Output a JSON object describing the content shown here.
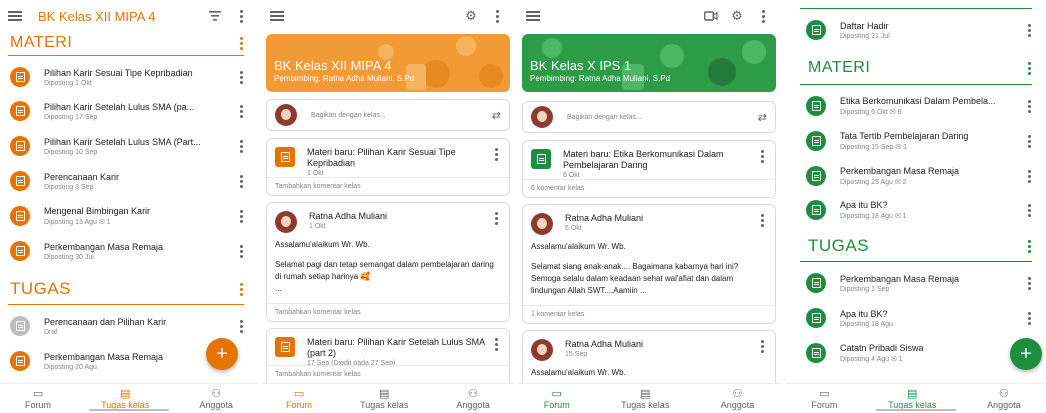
{
  "colors": {
    "orange": "#e37400",
    "green": "#1e8e3e",
    "grey_icon": "#bdbdbd"
  },
  "screen1": {
    "title": "BK Kelas XII MIPA 4",
    "materi_header": "MATERI",
    "materi": [
      {
        "title": "Pilihan Karir Sesuai Tipe Kepribadian",
        "sub": "Diposting 1 Okt"
      },
      {
        "title": "Pilihan Karir Setelah Lulus SMA (pa...",
        "sub": "Diposting 17 Sep"
      },
      {
        "title": "Pilihan Karir Setelah Lulus SMA (Part...",
        "sub": "Diposting 10 Sep"
      },
      {
        "title": "Perencanaan Karir",
        "sub": "Diposting 3 Sep"
      },
      {
        "title": "Mengenal Bimbingan Karir",
        "sub": "Diposting 13 Agu  ✉ 1"
      },
      {
        "title": "Perkembangan Masa Remaja",
        "sub": "Diposting 30 Jul"
      }
    ],
    "tugas_header": "TUGAS",
    "tugas": [
      {
        "title": "Perencanaan dan Pilihan Karir",
        "sub": "Draf"
      },
      {
        "title": "Perkembangan Masa Remaja",
        "sub": "Diposting 20 Agu"
      }
    ],
    "fab": "+",
    "nav": {
      "forum": "Forum",
      "tugas": "Tugas kelas",
      "anggota": "Anggota"
    }
  },
  "screen2": {
    "banner_title": "BK Kelas XII MIPA 4",
    "banner_sub": "Pembimbing: Ratna Adha Muliani, S.Pd",
    "share_placeholder": "Bagikan dengan kelas...",
    "post1": {
      "title": "Materi baru: Pilihan Karir Sesuai Tipe Kepribadian",
      "date": "1 Okt",
      "foot": "Tambahkan komentar kelas"
    },
    "post2": {
      "author": "Ratna Adha Muliani",
      "date": "1 Okt",
      "line1": "Assalamu'alaikum Wr. Wb.",
      "line2": "Selamat pagi dan tetap semangat dalam pembelajaran daring di rumah setiap harinya 🥰",
      "line3": "...",
      "foot": "Tambahkan komentar kelas"
    },
    "post3": {
      "title": "Materi baru: Pilihan Karir Setelah Lulus SMA (part 2)",
      "date": "17 Sep (Diedit pada 27 Sep)",
      "foot": "Tambahkan komentar kelas"
    },
    "nav": {
      "forum": "Forum",
      "tugas": "Tugas kelas",
      "anggota": "Anggota"
    }
  },
  "screen3": {
    "banner_title": "BK Kelas X IPS 1",
    "banner_sub": "Pembimbing: Ratna Adha Muliani, S.Pd",
    "share_placeholder": "Bagikan dengan kelas...",
    "post1": {
      "title": "Materi baru: Etika Berkomunikasi Dalam Pembelajaran Daring",
      "date": "6 Okt",
      "foot": "6 komentar kelas"
    },
    "post2": {
      "author": "Ratna Adha Muliani",
      "date": "6 Okt",
      "line1": "Assalamu'alaikum Wr. Wb.",
      "line2": "Selamat siang anak-anak.... Bagaimana kabarnya hari ini? Semoga selalu dalam keadaan sehat wal'afiat dan dalam lindungan Allah SWT....Aamiin ...",
      "foot": "1 komentar kelas"
    },
    "post3": {
      "author": "Ratna Adha Muliani",
      "date": "15 Sep",
      "line1": "Assalamu'alaikum Wr. Wb."
    },
    "nav": {
      "forum": "Forum",
      "tugas": "Tugas kelas",
      "anggota": "Anggota"
    }
  },
  "screen4": {
    "top_item": {
      "title": "Daftar Hadir",
      "sub": "Diposting 21 Jul"
    },
    "materi_header": "MATERI",
    "materi": [
      {
        "title": "Etika Berkomunikasi Dalam Pembela...",
        "sub": "Diposting 6 Okt  ✉ 6"
      },
      {
        "title": "Tata Tertib Pembelajaran Daring",
        "sub": "Diposting 15 Sep  ✉ 1"
      },
      {
        "title": "Perkembangan Masa Remaja",
        "sub": "Diposting 25 Agu  ✉ 2"
      },
      {
        "title": "Apa itu BK?",
        "sub": "Diposting 18 Agu  ✉ 1"
      }
    ],
    "tugas_header": "TUGAS",
    "tugas": [
      {
        "title": "Perkembangan Masa Remaja",
        "sub": "Diposting 1 Sep"
      },
      {
        "title": "Apa itu BK?",
        "sub": "Diposting 18 Agu"
      },
      {
        "title": "Catatn Pribadi Siswa",
        "sub": "Diposting 4 Agu  ✉ 1"
      }
    ],
    "fab": "+",
    "nav": {
      "forum": "Forum",
      "tugas": "Tugas kelas",
      "anggota": "Anggota"
    }
  }
}
